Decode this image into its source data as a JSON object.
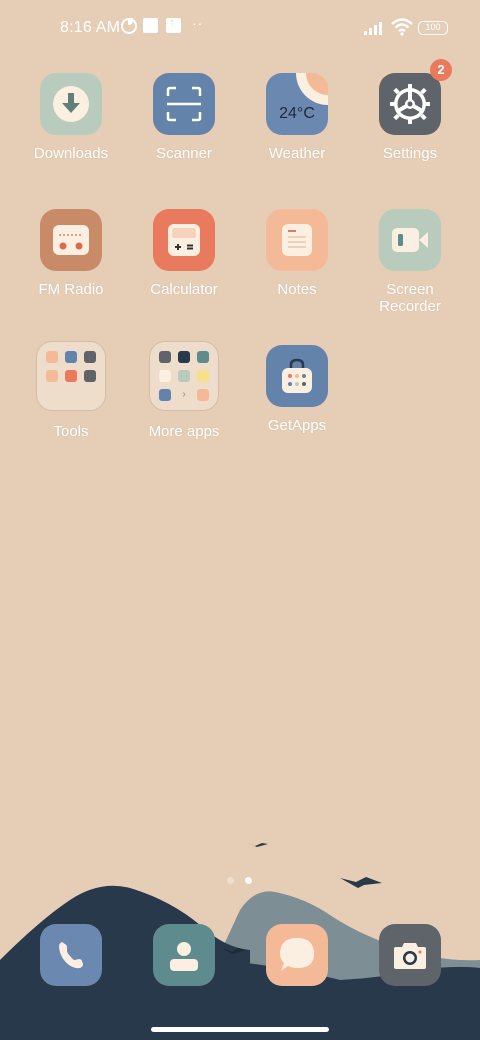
{
  "status_bar": {
    "time": "8:16 AM",
    "more": "··",
    "battery": "100",
    "icons": [
      "data-saver-icon",
      "notification-square-icon",
      "upload-icon",
      "signal-icon",
      "wifi-icon",
      "battery-icon"
    ]
  },
  "apps": [
    {
      "label": "Downloads",
      "icon": "download-icon",
      "color": "#b9cbbd"
    },
    {
      "label": "Scanner",
      "icon": "scanner-icon",
      "color": "#6483ab"
    },
    {
      "label": "Weather",
      "icon": "weather-icon",
      "color": "#6a88b0",
      "temp": "24°C"
    },
    {
      "label": "Settings",
      "icon": "gear-icon",
      "color": "#5e6469",
      "badge": "2"
    },
    {
      "label": "FM Radio",
      "icon": "radio-icon",
      "color": "#c98a68"
    },
    {
      "label": "Calculator",
      "icon": "calculator-icon",
      "color": "#ea7a5e"
    },
    {
      "label": "Notes",
      "icon": "notes-icon",
      "color": "#f4b996"
    },
    {
      "label": "Screen Recorder",
      "icon": "video-camera-icon",
      "color": "#b9cbbd"
    },
    {
      "label": "Tools",
      "icon": "folder-icon"
    },
    {
      "label": "More apps",
      "icon": "folder-icon"
    },
    {
      "label": "GetApps",
      "icon": "shopping-bag-icon",
      "color": "#6483ab"
    }
  ],
  "dock": [
    {
      "name": "phone",
      "icon": "phone-icon",
      "color": "#6a88b0"
    },
    {
      "name": "contacts",
      "icon": "contact-icon",
      "color": "#5e8b8e"
    },
    {
      "name": "messages",
      "icon": "chat-bubble-icon",
      "color": "#f4b996"
    },
    {
      "name": "camera",
      "icon": "camera-icon",
      "color": "#5e6469"
    }
  ],
  "page_indicator": {
    "pages": 2,
    "current": 2
  },
  "colors": {
    "wallpaper": "#e6ceb6",
    "badge": "#ea7a5e",
    "mountain_dark": "#27394a",
    "mountain_mid": "#7e8e95"
  }
}
